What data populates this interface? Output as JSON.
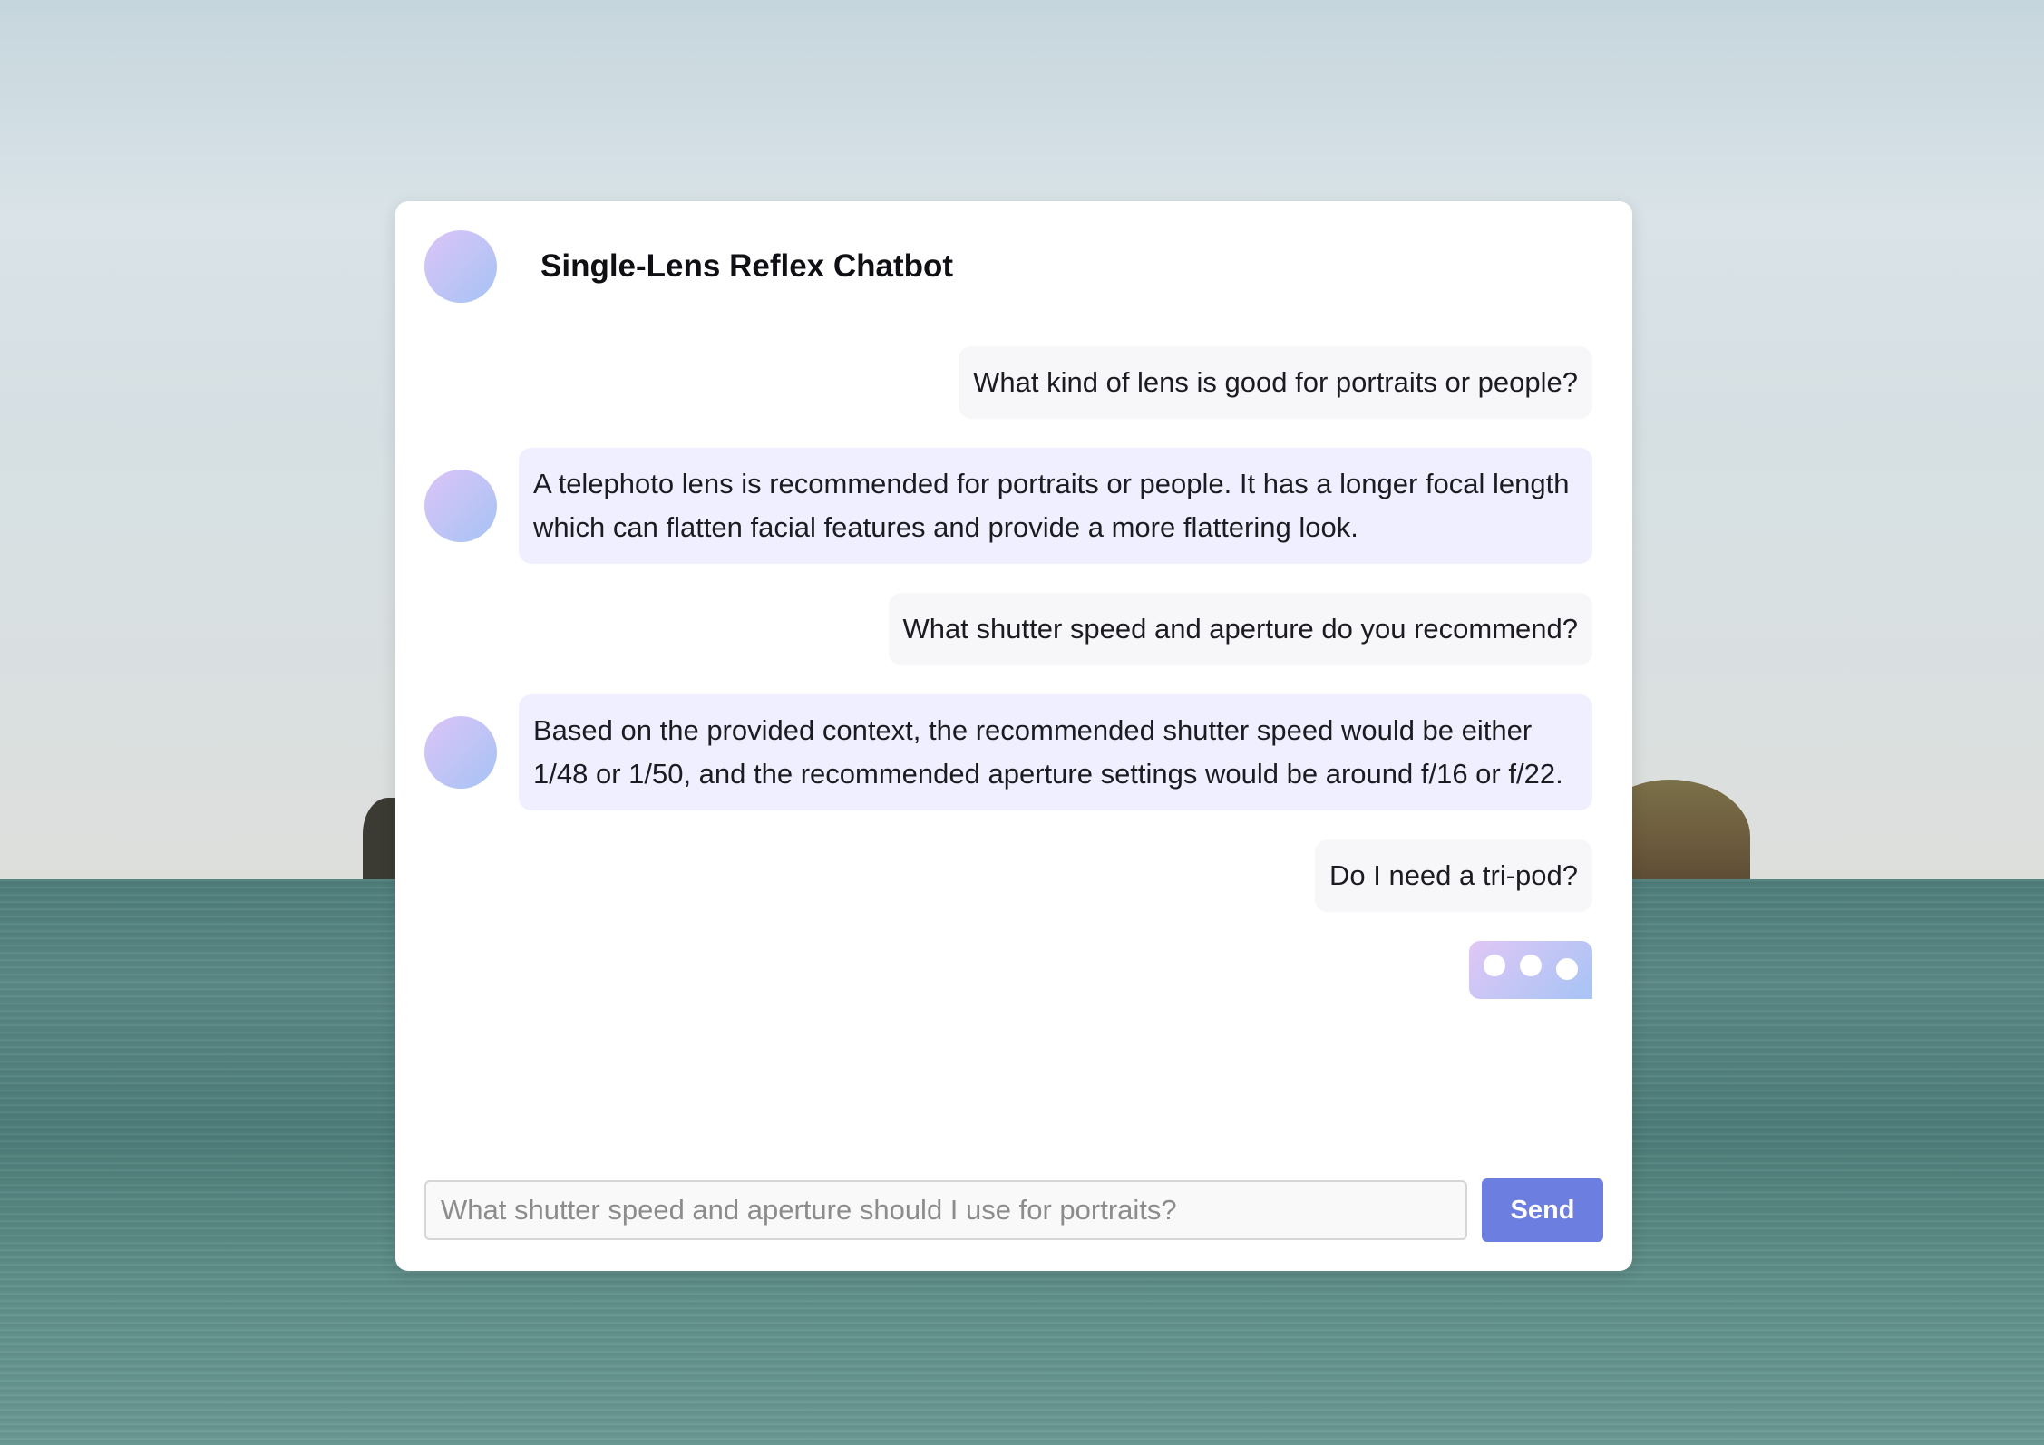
{
  "chat": {
    "title": "Single-Lens Reflex Chatbot",
    "messages": [
      {
        "role": "user",
        "text": "What kind of lens is good for portraits or people?"
      },
      {
        "role": "bot",
        "text": "A telephoto lens is recommended for portraits or people. It has a longer focal length which can flatten facial features and provide a more flattering look."
      },
      {
        "role": "user",
        "text": "What shutter speed and aperture do you recommend?"
      },
      {
        "role": "bot",
        "text": "Based on the provided context, the recommended shutter speed would be either 1/48 or 1/50, and the recommended aperture settings would be around f/16 or f/22."
      },
      {
        "role": "user",
        "text": "Do I need a tri-pod?"
      }
    ],
    "typing_indicator": true
  },
  "composer": {
    "placeholder": "What shutter speed and aperture should I use for portraits?",
    "value": "",
    "send_label": "Send"
  },
  "colors": {
    "accent": "#6d7ee1",
    "avatar_gradient_start": "#dcc4f6",
    "avatar_gradient_end": "#a6c3f5",
    "bot_bubble": "#f0efff",
    "user_bubble": "#f7f6f9"
  }
}
